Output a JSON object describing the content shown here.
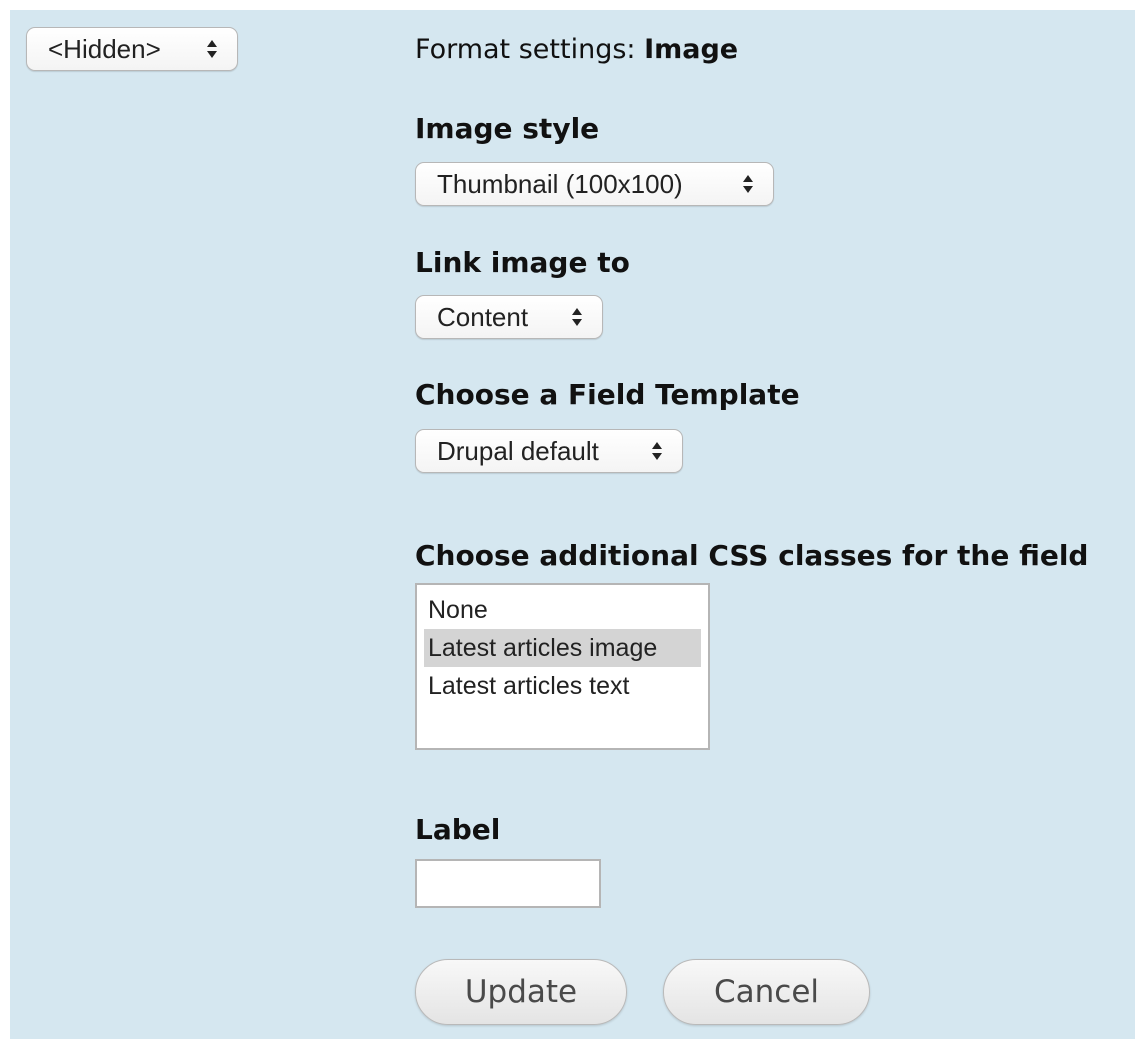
{
  "format_selector": {
    "value": "<Hidden>"
  },
  "format_settings": {
    "prefix": "Format settings: ",
    "name": "Image"
  },
  "image_style": {
    "heading": "Image style",
    "value": "Thumbnail (100x100)"
  },
  "link_image": {
    "heading": "Link image to",
    "value": "Content"
  },
  "field_template": {
    "heading": "Choose a Field Template",
    "value": "Drupal default"
  },
  "css_classes": {
    "heading": "Choose additional CSS classes for the field",
    "options": [
      "None",
      "Latest articles image",
      "Latest articles text"
    ],
    "selected": "Latest articles image"
  },
  "label_field": {
    "heading": "Label",
    "value": ""
  },
  "buttons": {
    "update": "Update",
    "cancel": "Cancel"
  },
  "colors": {
    "panel_bg": "#d5e7f0",
    "selected_option_bg": "#d4d4d4"
  }
}
